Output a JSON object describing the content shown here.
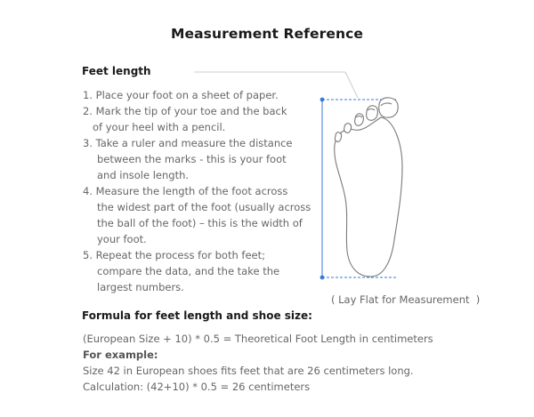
{
  "title": "Measurement Reference",
  "feet_length": {
    "heading": "Feet length",
    "steps": [
      [
        "1. Place your foot on a sheet of paper."
      ],
      [
        "2. Mark the tip of your toe and the back",
        "of your heel with a pencil."
      ],
      [
        "3. Take a ruler and measure the distance",
        "between the marks - this is your foot",
        "and insole length."
      ],
      [
        "4. Measure the length of the foot across",
        "the widest part of the foot (usually across",
        "the ball of the foot) – this is the width of",
        "your foot."
      ],
      [
        "5. Repeat the process for both feet;",
        "compare the data, and the take the",
        "largest numbers."
      ]
    ],
    "caption": "( Lay Flat for Measurement  )"
  },
  "formula": {
    "heading": "Formula for feet length and shoe size:",
    "line1": "(European Size + 10) * 0.5 = Theoretical Foot Length in centimeters",
    "example_label": "For example:",
    "line2": "Size 42 in European shoes fits feet that are 26 centimeters long.",
    "line3": "Calculation: (42+10) * 0.5 = 26 centimeters"
  },
  "colors": {
    "measure_line": "#3a7bd5",
    "foot_outline": "#7a7a7a",
    "leader_line": "#cccccc"
  },
  "icons": {
    "foot": "foot-outline-icon"
  }
}
